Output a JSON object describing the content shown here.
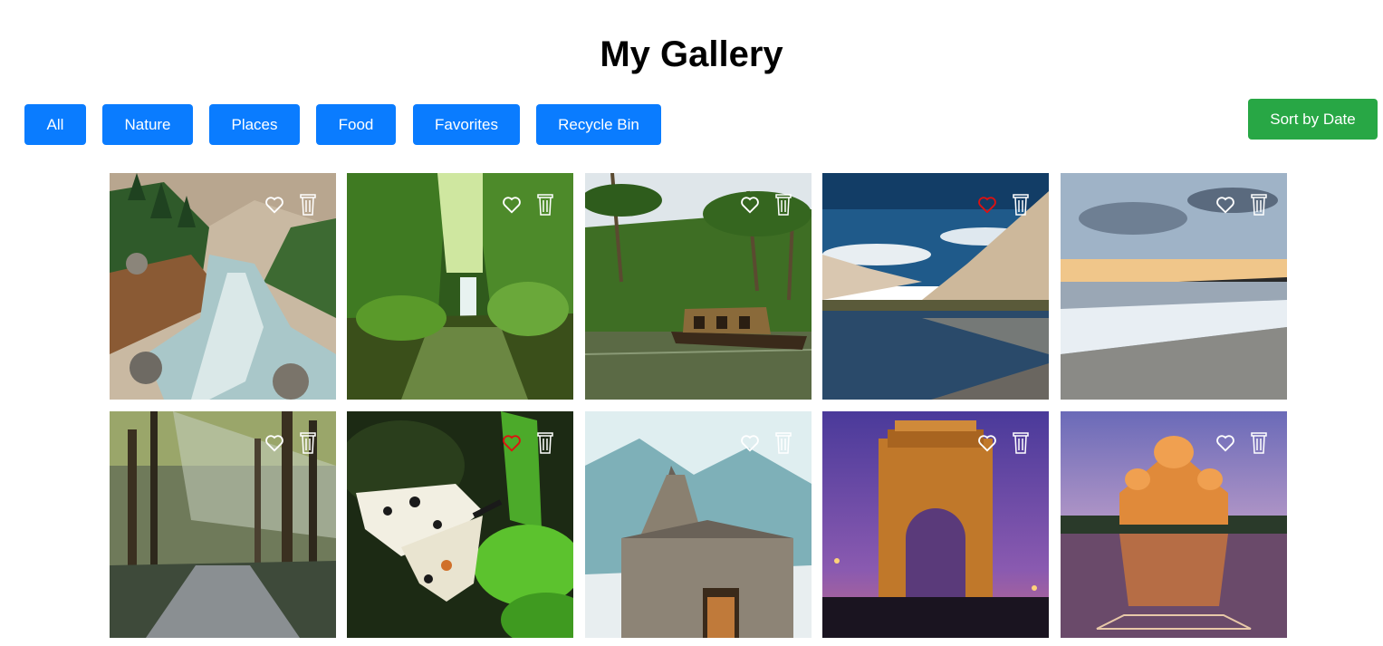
{
  "header": {
    "title": "My Gallery"
  },
  "filters": [
    {
      "label": "All"
    },
    {
      "label": "Nature"
    },
    {
      "label": "Places"
    },
    {
      "label": "Food"
    },
    {
      "label": "Favorites"
    },
    {
      "label": "Recycle Bin"
    }
  ],
  "sort": {
    "label": "Sort by Date"
  },
  "colors": {
    "primary": "#0a7cff",
    "success": "#28a745",
    "favorite": "#e01010",
    "icon": "#ffffff"
  },
  "gallery": {
    "items": [
      {
        "scene": "mountain-river",
        "favorite": false
      },
      {
        "scene": "waterfall",
        "favorite": false
      },
      {
        "scene": "houseboat-backwaters",
        "favorite": false
      },
      {
        "scene": "mountain-lake",
        "favorite": true
      },
      {
        "scene": "beach-sunset",
        "favorite": false
      },
      {
        "scene": "forest-path",
        "favorite": false
      },
      {
        "scene": "butterfly",
        "favorite": true
      },
      {
        "scene": "snow-temple",
        "favorite": false
      },
      {
        "scene": "india-gate",
        "favorite": false
      },
      {
        "scene": "akshardham-temple",
        "favorite": false
      }
    ],
    "icons": {
      "favorite": "heart-icon",
      "delete": "trash-icon"
    }
  }
}
